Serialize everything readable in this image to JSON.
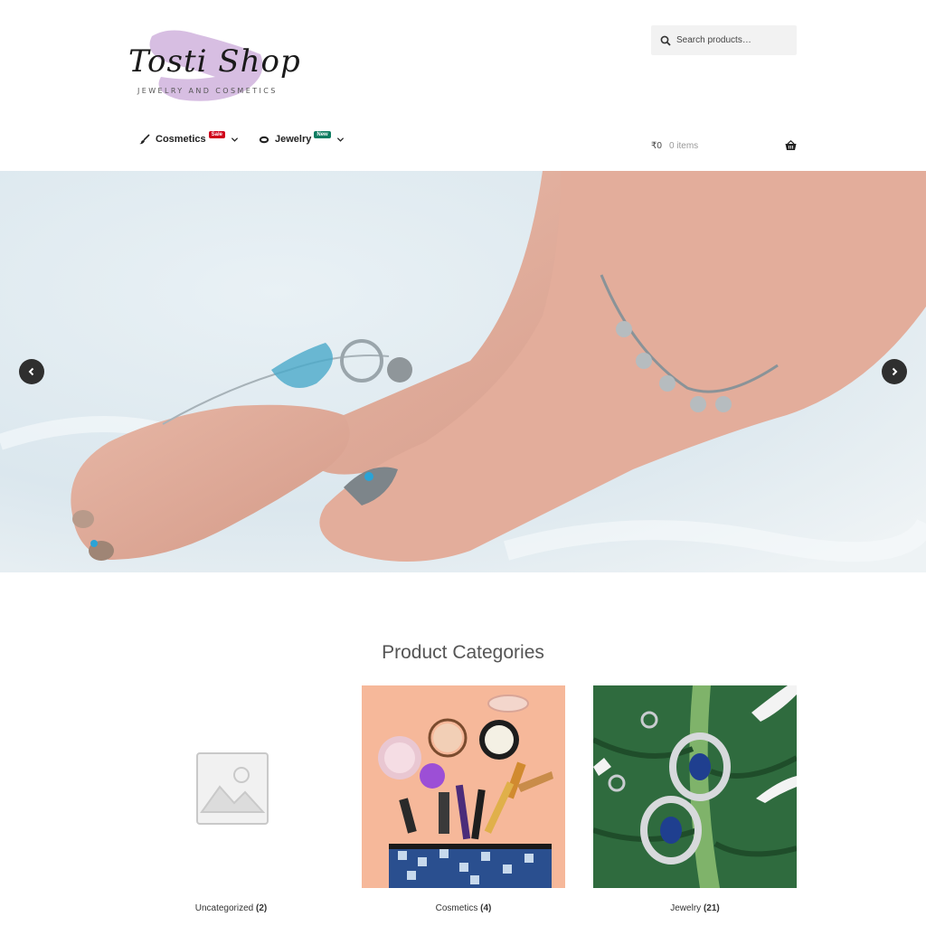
{
  "brand": {
    "logo_text": "Tosti Shop",
    "tagline": "JEWELRY AND COSMETICS",
    "accent": "#b892c8"
  },
  "search": {
    "placeholder": "Search products…",
    "icon": "search-icon"
  },
  "nav": {
    "items": [
      {
        "label": "Cosmetics",
        "badge": "Sale",
        "badge_color": "#d0021b",
        "icon": "brush-icon"
      },
      {
        "label": "Jewelry",
        "badge": "New",
        "badge_color": "#0e7c61",
        "icon": "ring-icon"
      }
    ]
  },
  "cart": {
    "amount": "₹0",
    "count": "0 items",
    "icon": "basket-icon"
  },
  "slider": {
    "prev_icon": "chevron-left-icon",
    "next_icon": "chevron-right-icon"
  },
  "categories": {
    "title": "Product Categories",
    "items": [
      {
        "name": "Uncategorized",
        "count": "(2)",
        "image": "placeholder-image-icon"
      },
      {
        "name": "Cosmetics",
        "count": "(4)",
        "image": "cosmetics-photo"
      },
      {
        "name": "Jewelry",
        "count": "(21)",
        "image": "earrings-photo"
      }
    ]
  }
}
